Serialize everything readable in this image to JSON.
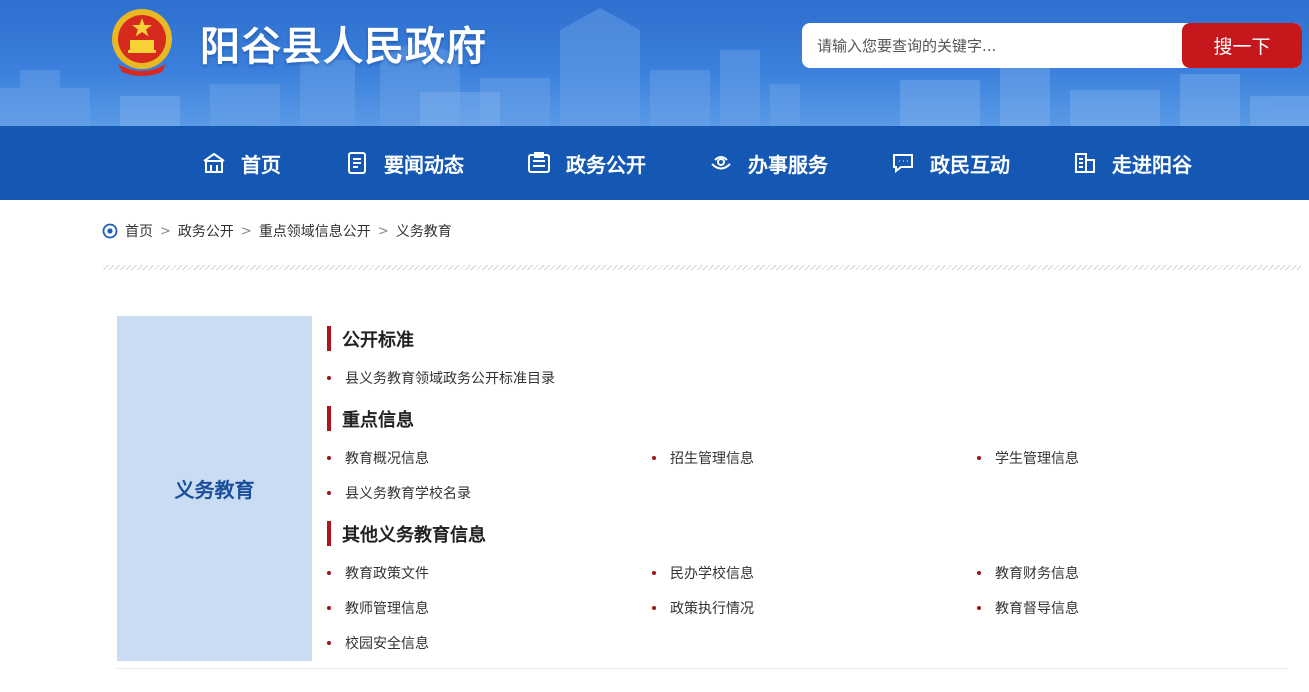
{
  "header": {
    "site_title": "阳谷县人民政府",
    "search_placeholder": "请输入您要查询的关键字...",
    "search_button": "搜一下"
  },
  "nav": [
    {
      "label": "首页",
      "icon": "home-icon"
    },
    {
      "label": "要闻动态",
      "icon": "news-icon"
    },
    {
      "label": "政务公开",
      "icon": "gov-affairs-icon"
    },
    {
      "label": "办事服务",
      "icon": "service-icon"
    },
    {
      "label": "政民互动",
      "icon": "chat-icon"
    },
    {
      "label": "走进阳谷",
      "icon": "building-icon"
    }
  ],
  "breadcrumb": [
    "首页",
    "政务公开",
    "重点领域信息公开",
    "义务教育"
  ],
  "breadcrumb_separator": ">",
  "side_panel_title": "义务教育",
  "sections": [
    {
      "title": "公开标准",
      "items": [
        "县义务教育领域政务公开标准目录"
      ]
    },
    {
      "title": "重点信息",
      "items": [
        "教育概况信息",
        "招生管理信息",
        "学生管理信息",
        "县义务教育学校名录"
      ]
    },
    {
      "title": "其他义务教育信息",
      "items": [
        "教育政策文件",
        "民办学校信息",
        "教育财务信息",
        "教师管理信息",
        "政策执行情况",
        "教育督导信息",
        "校园安全信息"
      ]
    }
  ],
  "colors": {
    "nav_bg": "#1458b4",
    "search_button": "#c6171c",
    "accent_red": "#b3141a",
    "side_panel": "#c9dcf2"
  }
}
